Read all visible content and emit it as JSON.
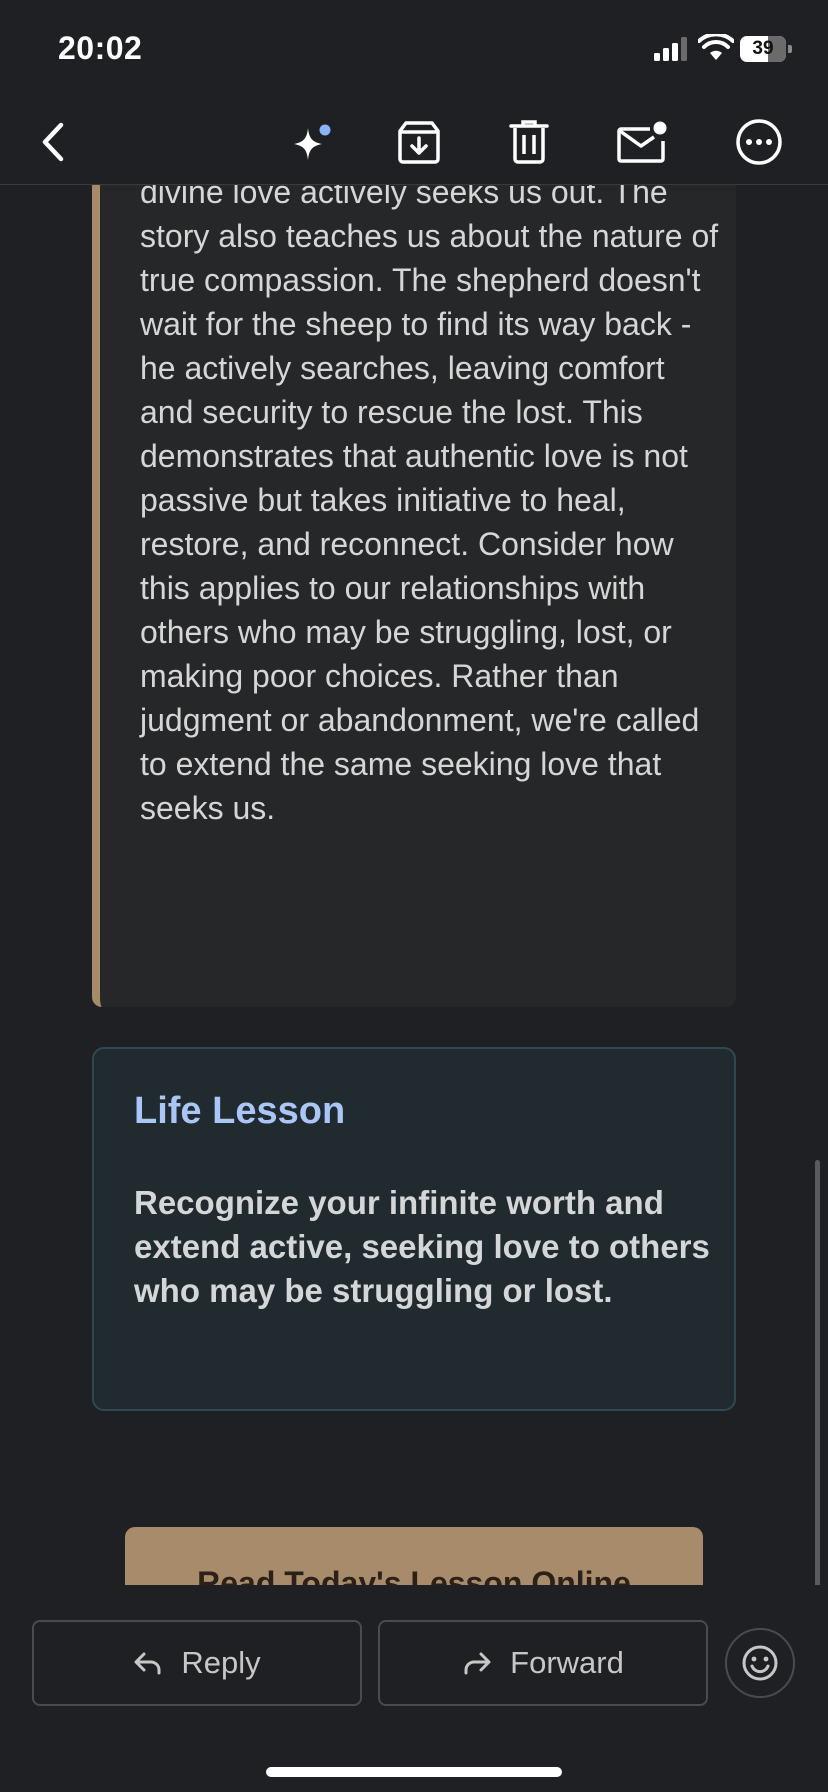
{
  "status_bar": {
    "time": "20:02",
    "battery": "39"
  },
  "toolbar": {
    "back": "back-arrow-icon",
    "gemini": "sparkle-icon",
    "archive": "archive-icon",
    "delete": "trash-icon",
    "mark_unread": "mail-unread-icon",
    "more": "more-horizontal-icon"
  },
  "message": {
    "quote_text": "divine love actively seeks us out. The story also teaches us about the nature of true compassion. The shepherd doesn't wait for the sheep to find its way back - he actively searches, leaving comfort and security to rescue the lost. This demonstrates that authentic love is not passive but takes initiative to heal, restore, and reconnect. Consider how this applies to our relationships with others who may be struggling, lost, or making poor choices. Rather than judgment or abandonment, we're called to extend the same seeking love that seeks us.",
    "lesson_title": "Life Lesson",
    "lesson_text": "Recognize your infinite worth and extend active, seeking love to others who may be struggling or lost.",
    "cta_label": "Read Today's Lesson Online"
  },
  "actions": {
    "reply": "Reply",
    "forward": "Forward",
    "emoji": "emoji-smile-icon"
  },
  "colors": {
    "background": "#1f2023",
    "accent_gold": "#a88b66",
    "lesson_title": "#a9c6f6",
    "lesson_card": "#212a2e"
  }
}
